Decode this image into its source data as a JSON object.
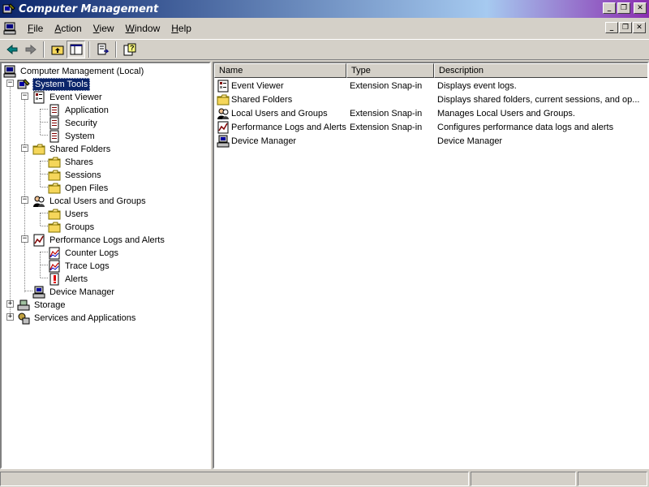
{
  "window": {
    "title": "Computer Management",
    "minimize_glyph": "_",
    "restore_glyph": "❐",
    "close_glyph": "✕"
  },
  "menubar": {
    "items": [
      {
        "label": "File",
        "accel": "F"
      },
      {
        "label": "Action",
        "accel": "A"
      },
      {
        "label": "View",
        "accel": "V"
      },
      {
        "label": "Window",
        "accel": "W"
      },
      {
        "label": "Help",
        "accel": "H"
      }
    ]
  },
  "toolbar": {
    "buttons": [
      "back-arrow-icon",
      "forward-arrow-icon",
      "up-folder-icon",
      "show-hide-tree-icon",
      "export-list-icon",
      "help-icon"
    ]
  },
  "tree": {
    "root": "Computer Management (Local)",
    "system_tools": "System Tools",
    "event_viewer": "Event Viewer",
    "application": "Application",
    "security": "Security",
    "system": "System",
    "shared_folders": "Shared Folders",
    "shares": "Shares",
    "sessions": "Sessions",
    "open_files": "Open Files",
    "local_users": "Local Users and Groups",
    "users": "Users",
    "groups": "Groups",
    "perf_logs": "Performance Logs and Alerts",
    "counter_logs": "Counter Logs",
    "trace_logs": "Trace Logs",
    "alerts": "Alerts",
    "device_manager": "Device Manager",
    "storage": "Storage",
    "services": "Services and Applications"
  },
  "list": {
    "columns": [
      "Name",
      "Type",
      "Description"
    ],
    "rows": [
      {
        "name": "Event Viewer",
        "type": "Extension Snap-in",
        "description": "Displays event logs."
      },
      {
        "name": "Shared Folders",
        "type": "",
        "description": "Displays shared folders, current sessions, and op..."
      },
      {
        "name": "Local Users and Groups",
        "type": "Extension Snap-in",
        "description": "Manages Local Users and Groups."
      },
      {
        "name": "Performance Logs and Alerts",
        "type": "Extension Snap-in",
        "description": "Configures performance data logs and alerts"
      },
      {
        "name": "Device Manager",
        "type": "",
        "description": "Device Manager"
      }
    ]
  },
  "colors": {
    "title_gradient_start": "#0a246a",
    "title_gradient_end": "#8a2fb0",
    "face": "#d4d0c8",
    "selection": "#0a246a"
  }
}
